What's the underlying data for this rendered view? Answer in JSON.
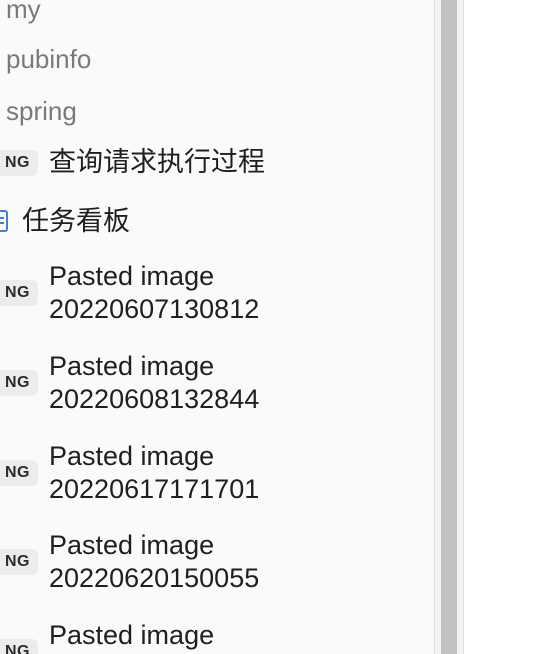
{
  "sidebar": {
    "folders": [
      {
        "label": "my"
      },
      {
        "label": "pubinfo"
      },
      {
        "label": "spring"
      }
    ],
    "files": [
      {
        "badge": "NG",
        "name": "查询请求执行过程"
      },
      {
        "icon": "board-icon",
        "name": "任务看板"
      },
      {
        "badge": "NG",
        "name_line1": "Pasted image",
        "name_line2": "20220607130812"
      },
      {
        "badge": "NG",
        "name_line1": "Pasted image",
        "name_line2": "20220608132844"
      },
      {
        "badge": "NG",
        "name_line1": "Pasted image",
        "name_line2": "20220617171701"
      },
      {
        "badge": "NG",
        "name_line1": "Pasted image",
        "name_line2": "20220620150055"
      },
      {
        "badge": "NG",
        "name_line1": "Pasted image"
      }
    ]
  },
  "colors": {
    "sidebar_bg": "#fafafa",
    "folder_text": "#7a7a7a",
    "file_text": "#1f1f1f",
    "badge_bg": "#ececec",
    "board_icon": "#4a7bd0",
    "scrollbar_thumb": "#c1c1c1"
  }
}
